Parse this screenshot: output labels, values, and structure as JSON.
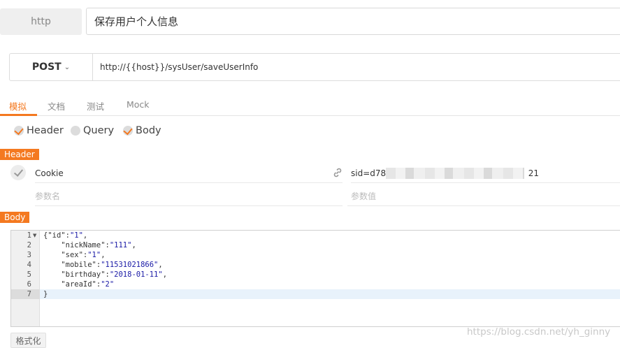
{
  "top": {
    "protocol": "http",
    "api_name": "保存用户个人信息"
  },
  "request": {
    "method": "POST",
    "url": "http://{{host}}/sysUser/saveUserInfo"
  },
  "tabs": [
    {
      "label": "模拟",
      "active": true
    },
    {
      "label": "文档",
      "active": false
    },
    {
      "label": "测试",
      "active": false
    },
    {
      "label": "Mock",
      "active": false
    }
  ],
  "options": [
    {
      "label": "Header",
      "checked": true
    },
    {
      "label": "Query",
      "checked": false
    },
    {
      "label": "Body",
      "checked": true
    }
  ],
  "header_section": {
    "label": "Header",
    "row": {
      "key": "Cookie",
      "value_prefix": "sid=d780",
      "value_suffix": "21"
    },
    "placeholder_key": "参数名",
    "placeholder_value": "参数值"
  },
  "body_section": {
    "label": "Body",
    "line_numbers": [
      "1",
      "2",
      "3",
      "4",
      "5",
      "6",
      "7"
    ],
    "lines": [
      {
        "pre": "{",
        "key": "\"id\"",
        "sep": ":",
        "val": "\"1\"",
        "post": ","
      },
      {
        "pre": "    ",
        "key": "\"nickName\"",
        "sep": ":",
        "val": "\"111\"",
        "post": ","
      },
      {
        "pre": "    ",
        "key": "\"sex\"",
        "sep": ":",
        "val": "\"1\"",
        "post": ","
      },
      {
        "pre": "    ",
        "key": "\"mobile\"",
        "sep": ":",
        "val": "\"11531021866\"",
        "post": ","
      },
      {
        "pre": "    ",
        "key": "\"birthday\"",
        "sep": ":",
        "val": "\"2018-01-11\"",
        "post": ","
      },
      {
        "pre": "    ",
        "key": "\"areaId\"",
        "sep": ":",
        "val": "\"2\"",
        "post": ""
      },
      {
        "pre": "}",
        "key": "",
        "sep": "",
        "val": "",
        "post": ""
      }
    ],
    "format_button": "格式化"
  },
  "watermark": "https://blog.csdn.net/yh_ginny",
  "colors": {
    "accent": "#f47920",
    "string": "#1a1aa6"
  }
}
